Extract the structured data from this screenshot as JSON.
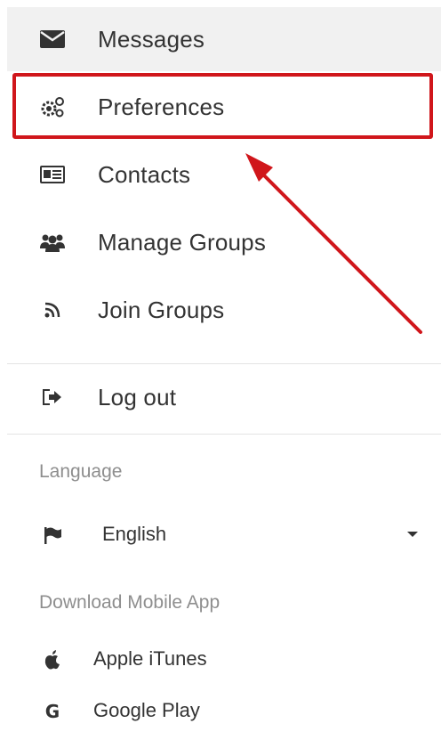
{
  "menu": {
    "messages": "Messages",
    "preferences": "Preferences",
    "contacts": "Contacts",
    "manage_groups": "Manage Groups",
    "join_groups": "Join Groups",
    "logout": "Log out"
  },
  "language": {
    "section_label": "Language",
    "selected": "English"
  },
  "mobile": {
    "section_label": "Download Mobile App",
    "apple": "Apple iTunes",
    "google": "Google Play",
    "google_glyph": "G"
  },
  "colors": {
    "highlight": "#d0161b",
    "active_bg": "#f1f1f1"
  }
}
